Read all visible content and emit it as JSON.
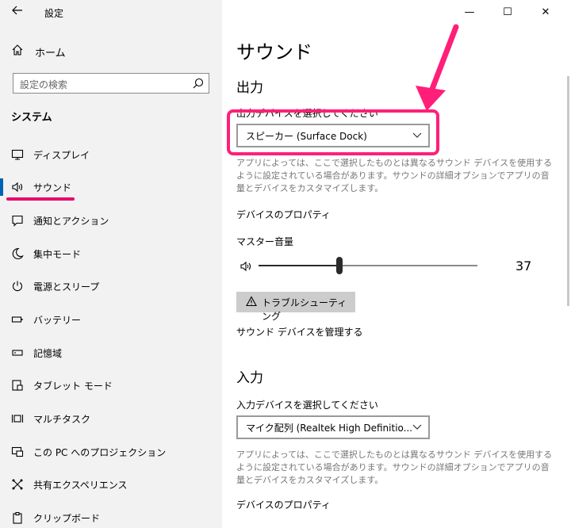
{
  "app": {
    "title": "設定",
    "back_icon": "back-arrow-icon"
  },
  "window_controls": {
    "minimize": "—",
    "maximize": "☐",
    "close": "✕"
  },
  "sidebar": {
    "home_label": "ホーム",
    "search_placeholder": "設定の検索",
    "section_title": "システム",
    "items": [
      {
        "label": "ディスプレイ",
        "icon": "display-icon"
      },
      {
        "label": "サウンド",
        "icon": "speaker-icon",
        "active": true
      },
      {
        "label": "通知とアクション",
        "icon": "notification-icon"
      },
      {
        "label": "集中モード",
        "icon": "moon-icon"
      },
      {
        "label": "電源とスリープ",
        "icon": "power-icon"
      },
      {
        "label": "バッテリー",
        "icon": "battery-icon"
      },
      {
        "label": "記憶域",
        "icon": "storage-icon"
      },
      {
        "label": "タブレット モード",
        "icon": "tablet-icon"
      },
      {
        "label": "マルチタスク",
        "icon": "multitask-icon"
      },
      {
        "label": "この PC へのプロジェクション",
        "icon": "projection-icon"
      },
      {
        "label": "共有エクスペリエンス",
        "icon": "share-icon"
      },
      {
        "label": "クリップボード",
        "icon": "clipboard-icon"
      }
    ]
  },
  "main": {
    "page_title": "サウンド",
    "output": {
      "heading": "出力",
      "device_label": "出力デバイスを選択してください",
      "device_value": "スピーカー (Surface Dock)",
      "help": "アプリによっては、ここで選択したものとは異なるサウンド デバイスを使用するように設定されている場合があります。サウンドの詳細オプションでアプリの音量とデバイスをカスタマイズします。",
      "properties_link": "デバイスのプロパティ",
      "master_volume_label": "マスター音量",
      "volume_value": "37",
      "volume_fraction": 0.37,
      "troubleshoot_label": "トラブルシューティング",
      "manage_link": "サウンド デバイスを管理する"
    },
    "input": {
      "heading": "入力",
      "device_label": "入力デバイスを選択してください",
      "device_value": "マイク配列 (Realtek High Definitio...",
      "help": "アプリによっては、ここで選択したものとは異なるサウンド デバイスを使用するように設定されている場合があります。サウンドの詳細オプションでアプリの音量とデバイスをカスタマイズします。",
      "properties_link": "デバイスのプロパティ"
    }
  },
  "colors": {
    "accent": "#0063b1",
    "annotation": "#ff1f78",
    "underline": "#e8006c"
  }
}
